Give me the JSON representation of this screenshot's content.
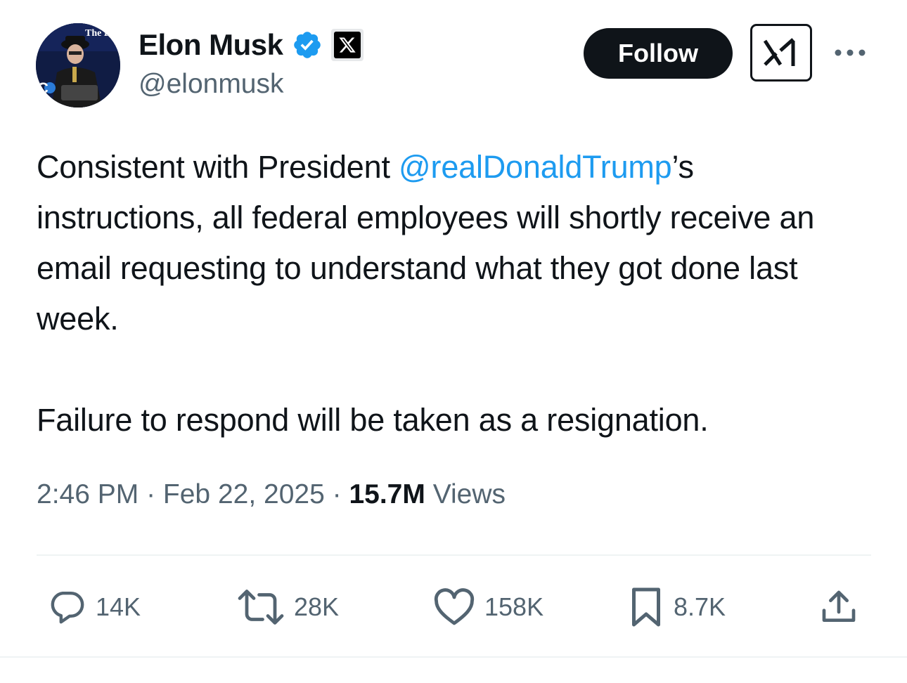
{
  "author": {
    "display_name": "Elon Musk",
    "handle": "@elonmusk",
    "verified_icon": "verified-badge-icon",
    "affiliate_icon": "x-logo-icon",
    "avatar_caption": "The Dogefa"
  },
  "header": {
    "follow_label": "Follow",
    "grok_icon": "grok-logo-icon",
    "more_icon": "more-dots-icon"
  },
  "tweet": {
    "line1_prefix": "Consistent with President ",
    "mention": "@realDonaldTrump",
    "line1_suffix": "’s instructions, all federal employees will shortly receive an email requesting to understand what they got done last week.",
    "paragraph2": "Failure to respond will be taken as a resignation."
  },
  "meta": {
    "time": "2:46 PM",
    "separator": " · ",
    "date": "Feb 22, 2025",
    "views_count": "15.7M",
    "views_label": " Views"
  },
  "actions": {
    "replies": "14K",
    "reposts": "28K",
    "likes": "158K",
    "bookmarks": "8.7K"
  },
  "colors": {
    "text": "#0f1419",
    "secondary": "#536471",
    "link": "#1d9bf0",
    "verified": "#1d9bf0",
    "divider": "#eff3f4"
  }
}
